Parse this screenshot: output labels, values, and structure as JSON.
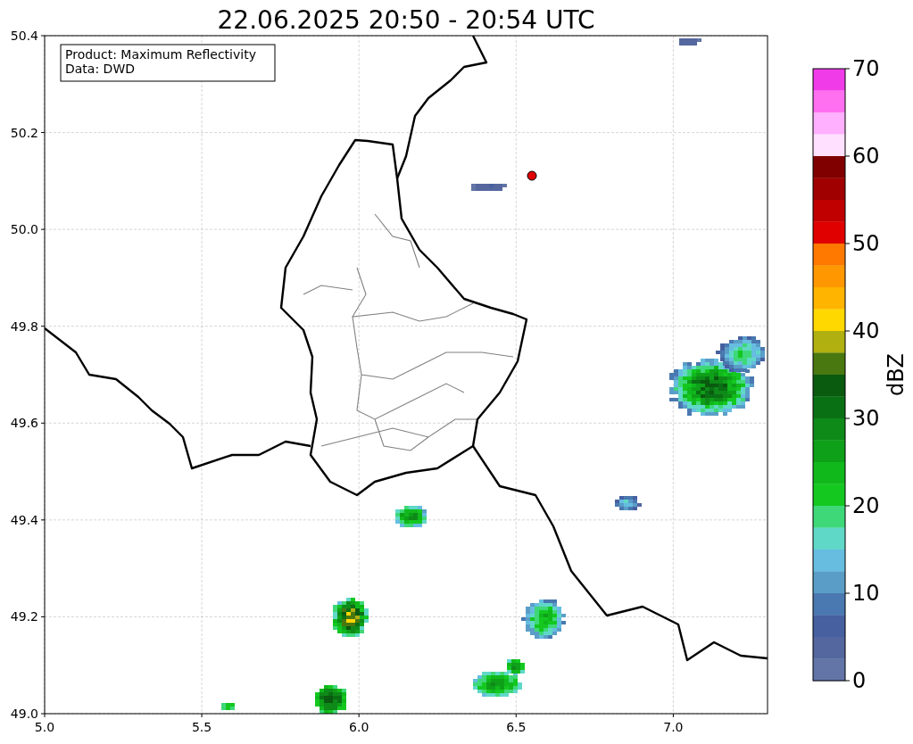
{
  "title": "22.06.2025 20:50 - 20:54 UTC",
  "info_box": {
    "lines": [
      "Product: Maximum Reflectivity",
      "Data: DWD"
    ]
  },
  "map": {
    "xticks": [
      "5.0",
      "5.5",
      "6.0",
      "6.5",
      "7.0"
    ],
    "yticks": [
      "50.4",
      "50.2",
      "50.0",
      "49.8",
      "49.6",
      "49.4",
      "49.2",
      "49.0"
    ]
  },
  "colorbar": {
    "label": "dBZ",
    "ticks": [
      "70",
      "60",
      "50",
      "40",
      "30",
      "20",
      "10",
      "0"
    ],
    "bins": [
      {
        "color": "#f03ce8"
      },
      {
        "color": "#ff70f0"
      },
      {
        "color": "#ffb0ff"
      },
      {
        "color": "#ffe0ff"
      },
      {
        "color": "#800000"
      },
      {
        "color": "#a00000"
      },
      {
        "color": "#c00000"
      },
      {
        "color": "#e00000"
      },
      {
        "color": "#ff7800"
      },
      {
        "color": "#ff9800"
      },
      {
        "color": "#ffb400"
      },
      {
        "color": "#ffd800"
      },
      {
        "color": "#b0b010"
      },
      {
        "color": "#4a7810"
      },
      {
        "color": "#0a5a10"
      },
      {
        "color": "#0a7014"
      },
      {
        "color": "#0e8a18"
      },
      {
        "color": "#0ea018"
      },
      {
        "color": "#10b81c"
      },
      {
        "color": "#14c820"
      },
      {
        "color": "#3ed878"
      },
      {
        "color": "#60d8c8"
      },
      {
        "color": "#66bde0"
      },
      {
        "color": "#5a9ec8"
      },
      {
        "color": "#4a78b0"
      },
      {
        "color": "#4660a0"
      },
      {
        "color": "#54679f"
      },
      {
        "color": "#6275a6"
      }
    ]
  }
}
